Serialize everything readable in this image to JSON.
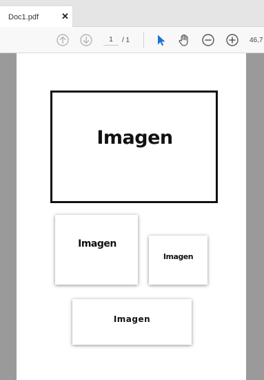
{
  "tab": {
    "title": "Doc1.pdf",
    "close": "✕"
  },
  "toolbar": {
    "prev_page": "arrow-up-circle-icon",
    "next_page": "arrow-down-circle-icon",
    "page_current": "1",
    "page_total": "/ 1",
    "select_tool": "pointer-icon",
    "hand_tool": "hand-icon",
    "zoom_out": "zoom-out-icon",
    "zoom_in": "zoom-in-icon",
    "zoom_value": "46,7",
    "accent_color": "#1a73d4"
  },
  "document": {
    "images": [
      {
        "label": "Imagen"
      },
      {
        "label": "Imagen"
      },
      {
        "label": "Imagen"
      },
      {
        "label": "Imagen"
      }
    ]
  }
}
